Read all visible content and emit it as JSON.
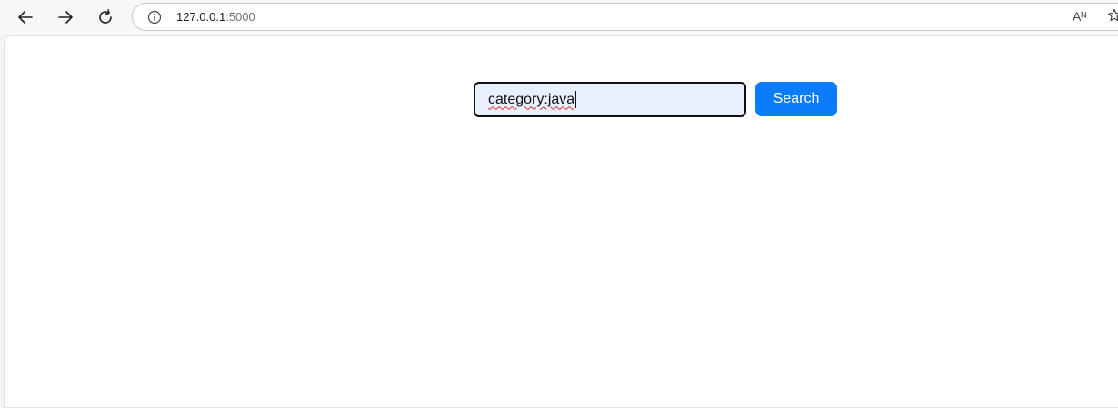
{
  "browser": {
    "address": {
      "host": "127.0.0.1",
      "port": ":5000"
    },
    "icons": {
      "back": "back-arrow-icon",
      "forward": "forward-arrow-icon",
      "reload": "reload-icon",
      "info": "info-icon",
      "read_aloud": "read-aloud-icon",
      "favorite": "star-icon"
    },
    "read_aloud_glyph": "Aᴺ"
  },
  "search": {
    "value": "category:java",
    "button_label": "Search"
  },
  "colors": {
    "button": "#0b7dfb",
    "input_background": "#e8f0fe"
  }
}
